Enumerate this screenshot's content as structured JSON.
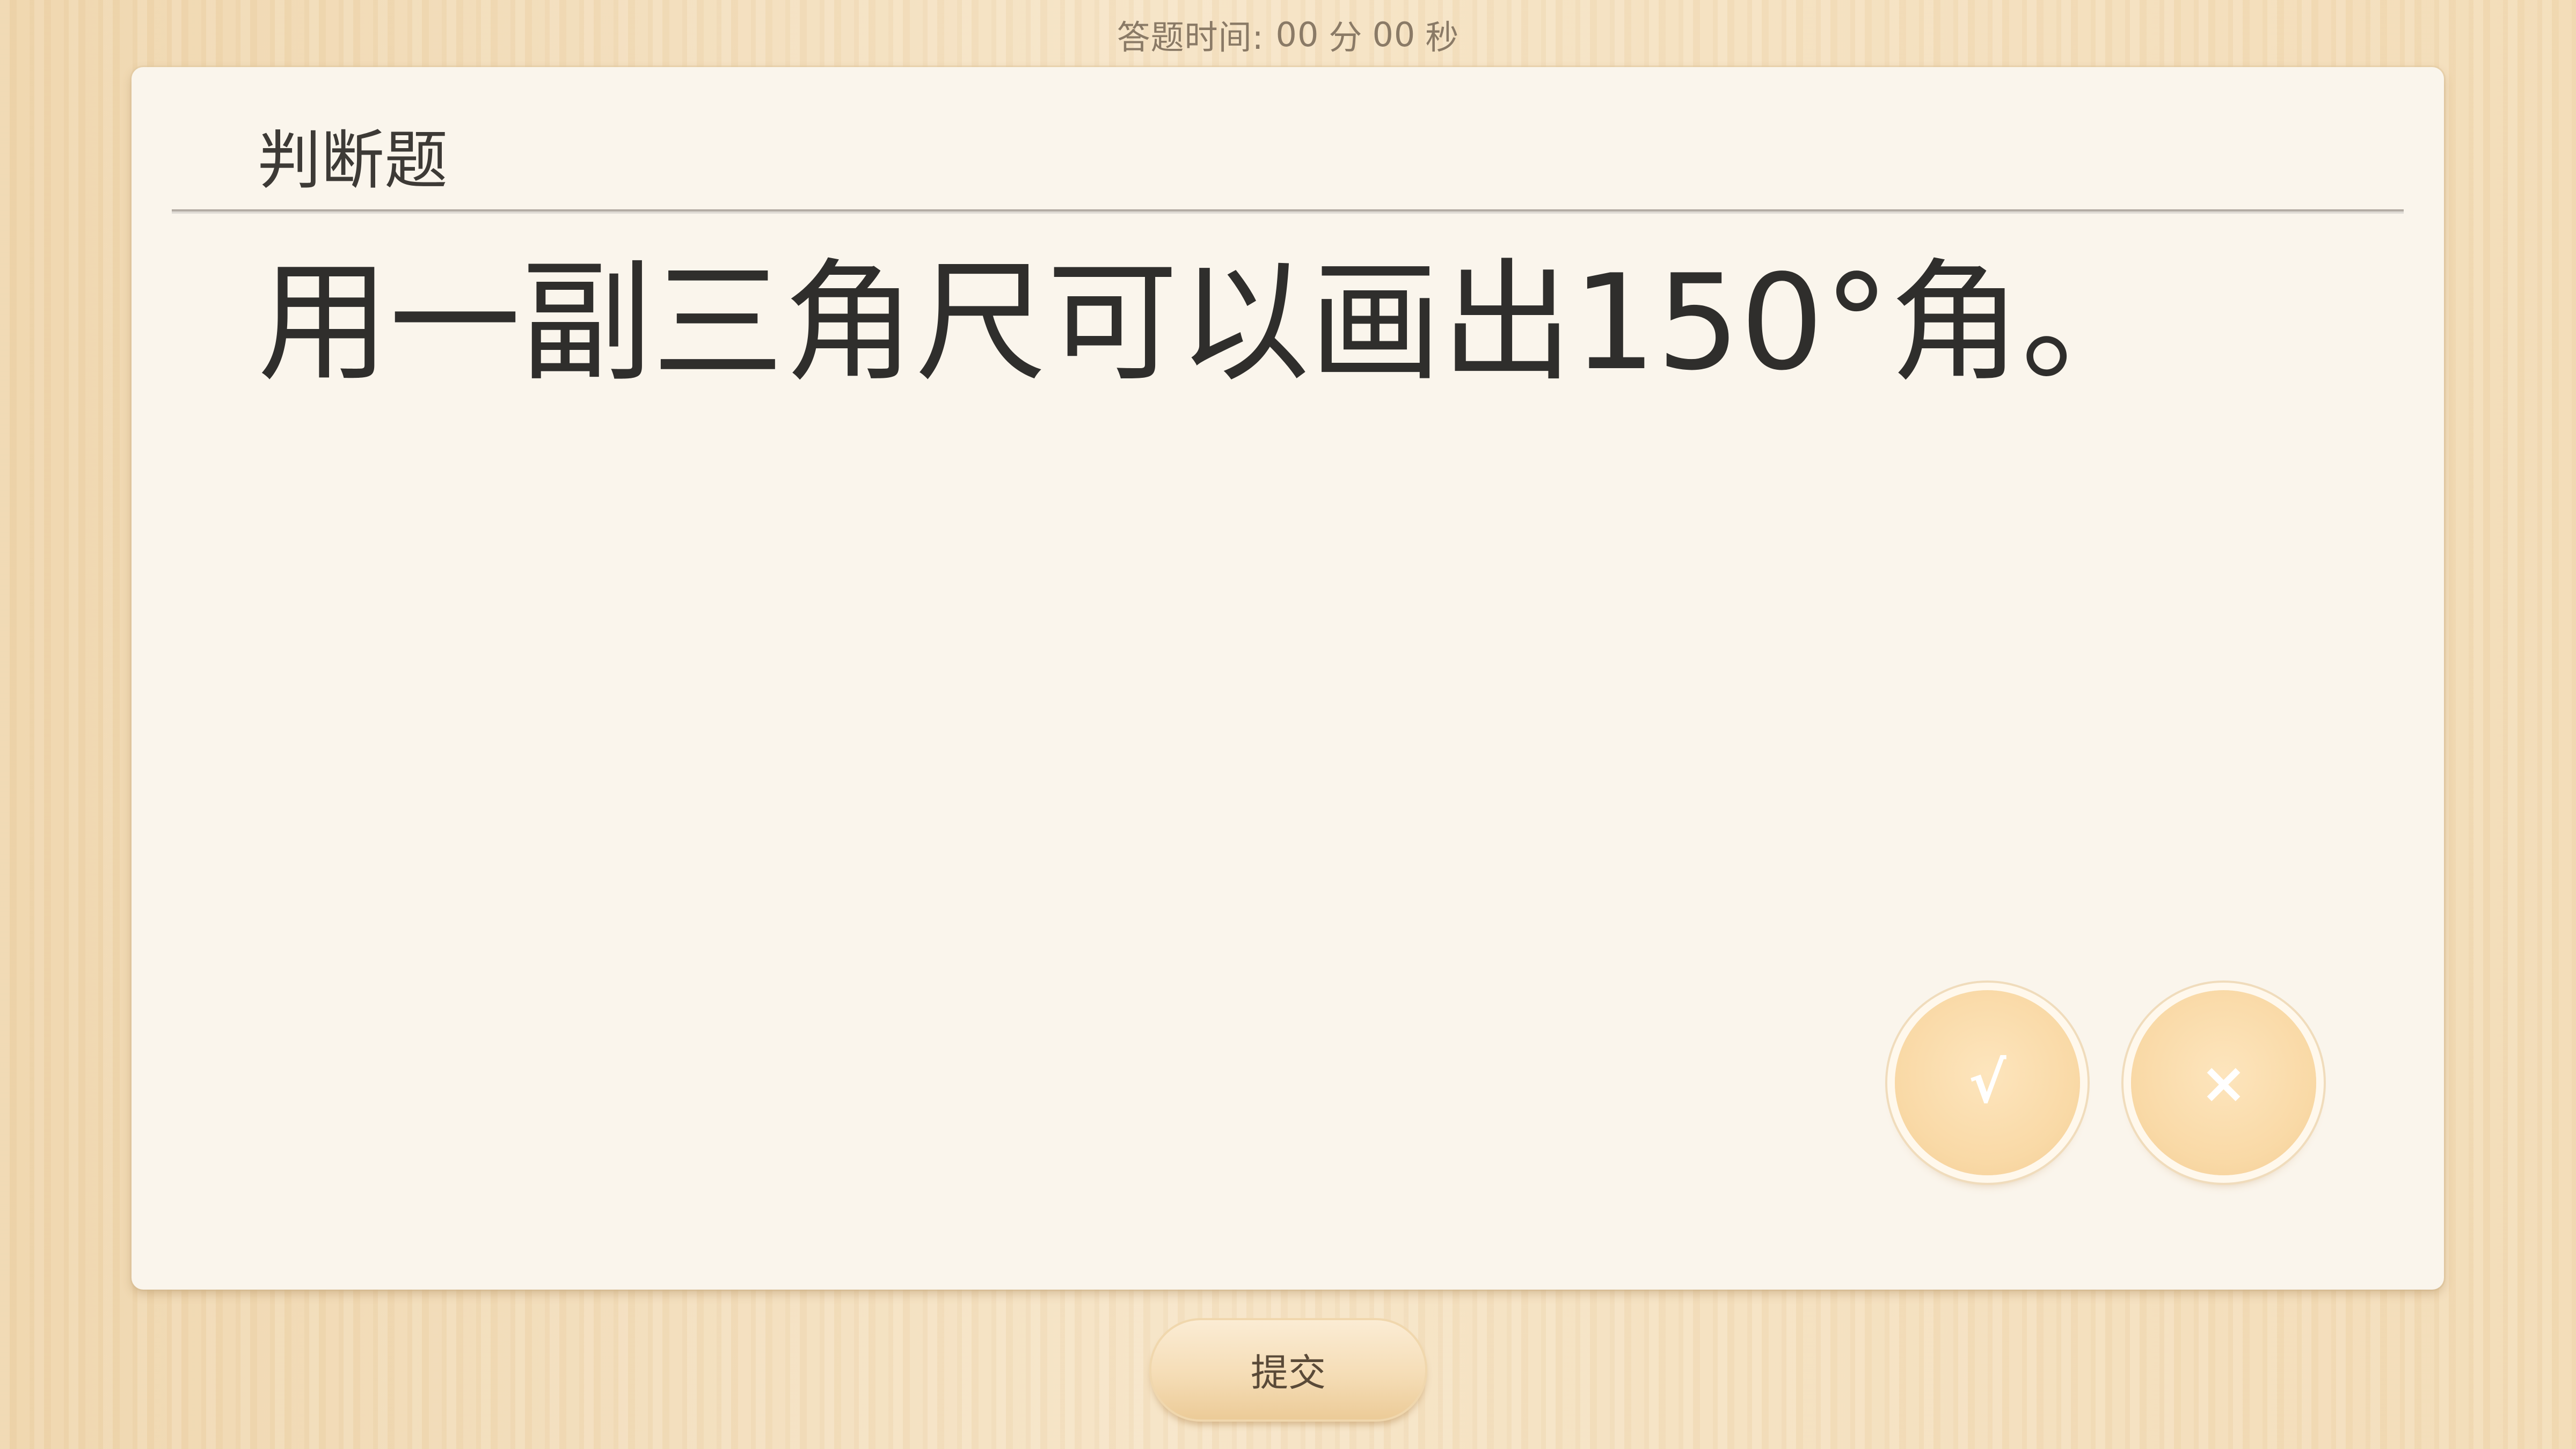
{
  "timer": {
    "label": "答题时间:",
    "minutes": "00",
    "minutes_unit": "分",
    "seconds": "00",
    "seconds_unit": "秒"
  },
  "card": {
    "question_type": "判断题",
    "question_text": "用一副三角尺可以画出150°角。"
  },
  "answers": {
    "true_label": "√",
    "false_label": "×"
  },
  "submit_label": "提交",
  "colors": {
    "background": "#f3ddb8",
    "card": "#faf5ec",
    "button": "#f9d9a6",
    "text_dark": "#2f2e2c",
    "timer_text": "#8a7a66"
  }
}
